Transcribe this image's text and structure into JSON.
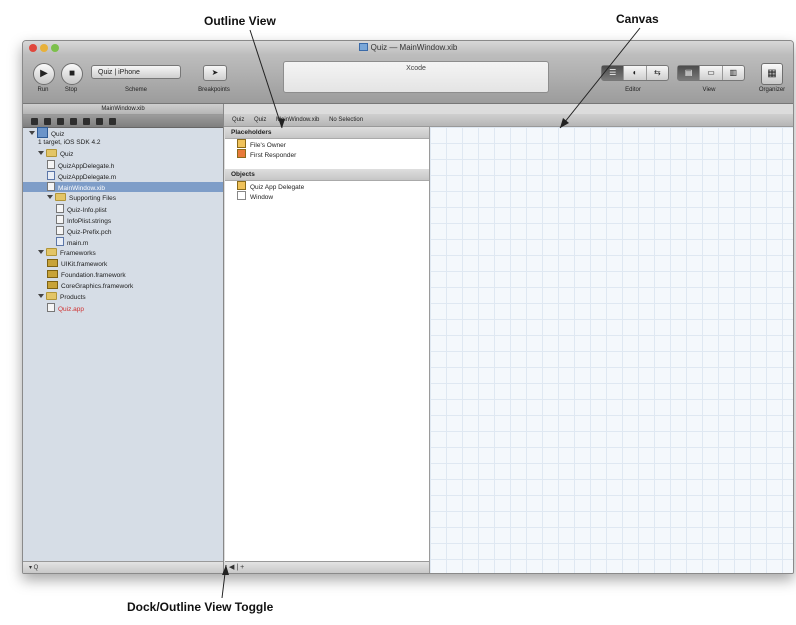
{
  "annotations": {
    "outline_view": "Outline View",
    "canvas": "Canvas",
    "dock_toggle": "Dock/Outline View Toggle"
  },
  "window": {
    "title": "Quiz — MainWindow.xib",
    "traffic_light_colors": [
      "#e0473c",
      "#e8b13a",
      "#7cc04b"
    ]
  },
  "toolbar": {
    "run_label": "Run",
    "stop_label": "Stop",
    "scheme_value": "Quiz | iPhone",
    "scheme_label": "Scheme",
    "breakpoints_label": "Breakpoints",
    "activity_text": "Xcode",
    "editor_label": "Editor",
    "view_label": "View",
    "organizer_label": "Organizer"
  },
  "navigator": {
    "title": "MainWindow.xib",
    "items": [
      {
        "label": "Quiz",
        "icon": "project-icon",
        "indent": 0
      },
      {
        "label": "1 target, iOS SDK 4.2",
        "icon": "none",
        "indent": 1
      },
      {
        "label": "Quiz",
        "icon": "folder-icon",
        "indent": 1
      },
      {
        "label": "QuizAppDelegate.h",
        "icon": "header-file-icon",
        "indent": 2
      },
      {
        "label": "QuizAppDelegate.m",
        "icon": "source-file-icon",
        "indent": 2
      },
      {
        "label": "MainWindow.xib",
        "icon": "xib-file-icon",
        "indent": 2,
        "selected": true
      },
      {
        "label": "Supporting Files",
        "icon": "folder-icon",
        "indent": 2
      },
      {
        "label": "Quiz-Info.plist",
        "icon": "plist-file-icon",
        "indent": 3
      },
      {
        "label": "InfoPlist.strings",
        "icon": "strings-file-icon",
        "indent": 3
      },
      {
        "label": "Quiz-Prefix.pch",
        "icon": "header-file-icon",
        "indent": 3
      },
      {
        "label": "main.m",
        "icon": "source-file-icon",
        "indent": 3
      },
      {
        "label": "Frameworks",
        "icon": "folder-icon",
        "indent": 1
      },
      {
        "label": "UIKit.framework",
        "icon": "framework-icon",
        "indent": 2
      },
      {
        "label": "Foundation.framework",
        "icon": "framework-icon",
        "indent": 2
      },
      {
        "label": "CoreGraphics.framework",
        "icon": "framework-icon",
        "indent": 2
      },
      {
        "label": "Products",
        "icon": "folder-icon",
        "indent": 1
      },
      {
        "label": "Quiz.app",
        "icon": "app-icon",
        "indent": 2,
        "missing": true
      }
    ],
    "filter_text": "▾ Q"
  },
  "jumpbar": {
    "crumbs": [
      "Quiz",
      "Quiz",
      "MainWindow.xib",
      "No Selection"
    ]
  },
  "outline": {
    "placeholders_header": "Placeholders",
    "placeholders": [
      {
        "label": "File's Owner",
        "color": "#f0c25a"
      },
      {
        "label": "First Responder",
        "color": "#e87a3a"
      }
    ],
    "objects_header": "Objects",
    "objects": [
      {
        "label": "Quiz App Delegate",
        "color": "#f0c25a"
      },
      {
        "label": "Window",
        "color": "#ffffff"
      }
    ],
    "toggle_text": "◀ | +"
  }
}
